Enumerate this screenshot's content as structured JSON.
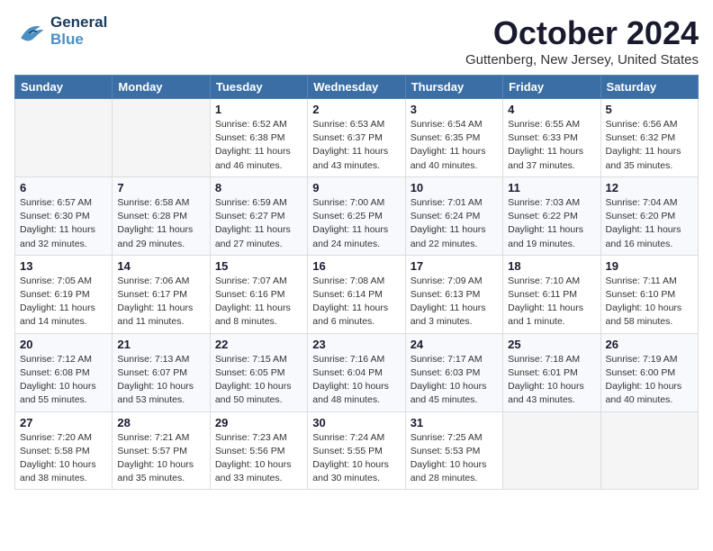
{
  "header": {
    "logo": {
      "general": "General",
      "blue": "Blue"
    },
    "title": "October 2024",
    "location": "Guttenberg, New Jersey, United States"
  },
  "calendar": {
    "days_of_week": [
      "Sunday",
      "Monday",
      "Tuesday",
      "Wednesday",
      "Thursday",
      "Friday",
      "Saturday"
    ],
    "weeks": [
      [
        {
          "day": "",
          "info": ""
        },
        {
          "day": "",
          "info": ""
        },
        {
          "day": "1",
          "info": "Sunrise: 6:52 AM\nSunset: 6:38 PM\nDaylight: 11 hours and 46 minutes."
        },
        {
          "day": "2",
          "info": "Sunrise: 6:53 AM\nSunset: 6:37 PM\nDaylight: 11 hours and 43 minutes."
        },
        {
          "day": "3",
          "info": "Sunrise: 6:54 AM\nSunset: 6:35 PM\nDaylight: 11 hours and 40 minutes."
        },
        {
          "day": "4",
          "info": "Sunrise: 6:55 AM\nSunset: 6:33 PM\nDaylight: 11 hours and 37 minutes."
        },
        {
          "day": "5",
          "info": "Sunrise: 6:56 AM\nSunset: 6:32 PM\nDaylight: 11 hours and 35 minutes."
        }
      ],
      [
        {
          "day": "6",
          "info": "Sunrise: 6:57 AM\nSunset: 6:30 PM\nDaylight: 11 hours and 32 minutes."
        },
        {
          "day": "7",
          "info": "Sunrise: 6:58 AM\nSunset: 6:28 PM\nDaylight: 11 hours and 29 minutes."
        },
        {
          "day": "8",
          "info": "Sunrise: 6:59 AM\nSunset: 6:27 PM\nDaylight: 11 hours and 27 minutes."
        },
        {
          "day": "9",
          "info": "Sunrise: 7:00 AM\nSunset: 6:25 PM\nDaylight: 11 hours and 24 minutes."
        },
        {
          "day": "10",
          "info": "Sunrise: 7:01 AM\nSunset: 6:24 PM\nDaylight: 11 hours and 22 minutes."
        },
        {
          "day": "11",
          "info": "Sunrise: 7:03 AM\nSunset: 6:22 PM\nDaylight: 11 hours and 19 minutes."
        },
        {
          "day": "12",
          "info": "Sunrise: 7:04 AM\nSunset: 6:20 PM\nDaylight: 11 hours and 16 minutes."
        }
      ],
      [
        {
          "day": "13",
          "info": "Sunrise: 7:05 AM\nSunset: 6:19 PM\nDaylight: 11 hours and 14 minutes."
        },
        {
          "day": "14",
          "info": "Sunrise: 7:06 AM\nSunset: 6:17 PM\nDaylight: 11 hours and 11 minutes."
        },
        {
          "day": "15",
          "info": "Sunrise: 7:07 AM\nSunset: 6:16 PM\nDaylight: 11 hours and 8 minutes."
        },
        {
          "day": "16",
          "info": "Sunrise: 7:08 AM\nSunset: 6:14 PM\nDaylight: 11 hours and 6 minutes."
        },
        {
          "day": "17",
          "info": "Sunrise: 7:09 AM\nSunset: 6:13 PM\nDaylight: 11 hours and 3 minutes."
        },
        {
          "day": "18",
          "info": "Sunrise: 7:10 AM\nSunset: 6:11 PM\nDaylight: 11 hours and 1 minute."
        },
        {
          "day": "19",
          "info": "Sunrise: 7:11 AM\nSunset: 6:10 PM\nDaylight: 10 hours and 58 minutes."
        }
      ],
      [
        {
          "day": "20",
          "info": "Sunrise: 7:12 AM\nSunset: 6:08 PM\nDaylight: 10 hours and 55 minutes."
        },
        {
          "day": "21",
          "info": "Sunrise: 7:13 AM\nSunset: 6:07 PM\nDaylight: 10 hours and 53 minutes."
        },
        {
          "day": "22",
          "info": "Sunrise: 7:15 AM\nSunset: 6:05 PM\nDaylight: 10 hours and 50 minutes."
        },
        {
          "day": "23",
          "info": "Sunrise: 7:16 AM\nSunset: 6:04 PM\nDaylight: 10 hours and 48 minutes."
        },
        {
          "day": "24",
          "info": "Sunrise: 7:17 AM\nSunset: 6:03 PM\nDaylight: 10 hours and 45 minutes."
        },
        {
          "day": "25",
          "info": "Sunrise: 7:18 AM\nSunset: 6:01 PM\nDaylight: 10 hours and 43 minutes."
        },
        {
          "day": "26",
          "info": "Sunrise: 7:19 AM\nSunset: 6:00 PM\nDaylight: 10 hours and 40 minutes."
        }
      ],
      [
        {
          "day": "27",
          "info": "Sunrise: 7:20 AM\nSunset: 5:58 PM\nDaylight: 10 hours and 38 minutes."
        },
        {
          "day": "28",
          "info": "Sunrise: 7:21 AM\nSunset: 5:57 PM\nDaylight: 10 hours and 35 minutes."
        },
        {
          "day": "29",
          "info": "Sunrise: 7:23 AM\nSunset: 5:56 PM\nDaylight: 10 hours and 33 minutes."
        },
        {
          "day": "30",
          "info": "Sunrise: 7:24 AM\nSunset: 5:55 PM\nDaylight: 10 hours and 30 minutes."
        },
        {
          "day": "31",
          "info": "Sunrise: 7:25 AM\nSunset: 5:53 PM\nDaylight: 10 hours and 28 minutes."
        },
        {
          "day": "",
          "info": ""
        },
        {
          "day": "",
          "info": ""
        }
      ]
    ]
  }
}
